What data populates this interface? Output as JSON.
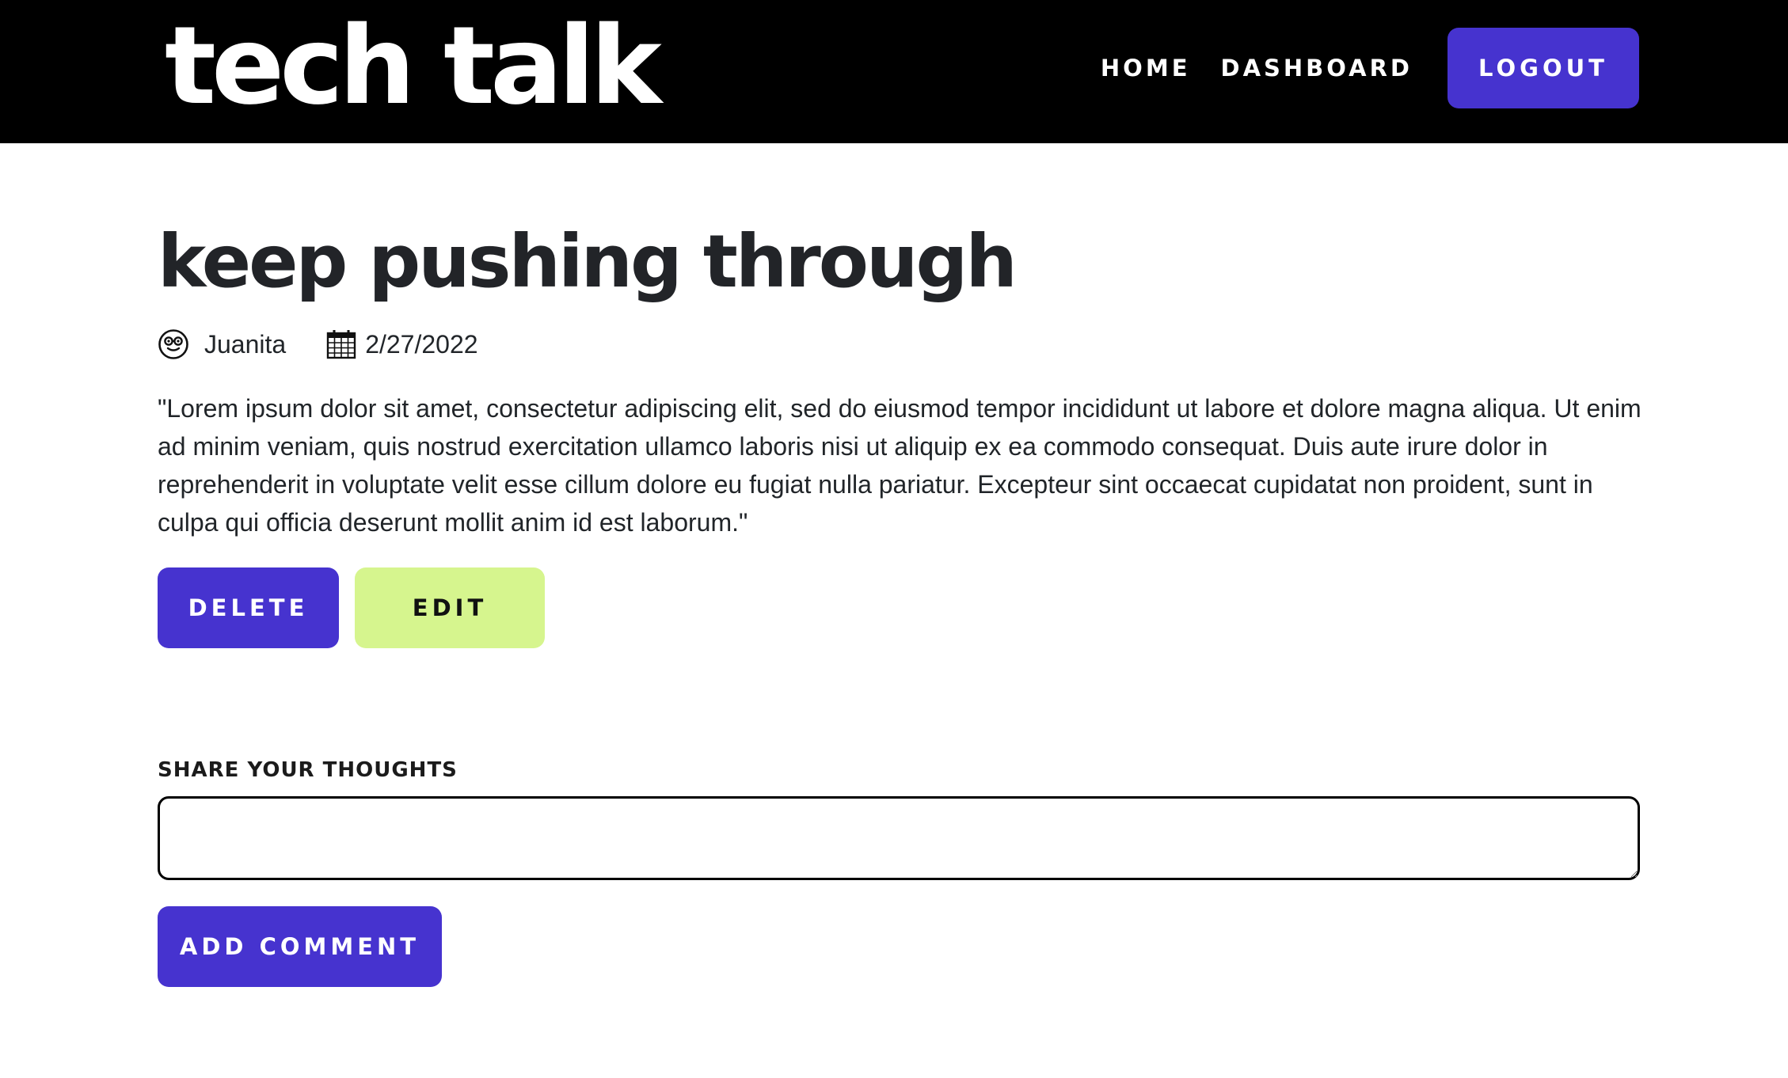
{
  "header": {
    "brand": "tech talk",
    "nav": {
      "home_label": "HOME",
      "dashboard_label": "DASHBOARD",
      "logout_label": "LOGOUT"
    }
  },
  "post": {
    "title": "keep pushing through",
    "author": "Juanita",
    "author_icon": "user-glasses-icon",
    "date": "2/27/2022",
    "date_icon": "calendar-icon",
    "body": "\"Lorem ipsum dolor sit amet, consectetur adipiscing elit, sed do eiusmod tempor incididunt ut labore et dolore magna aliqua. Ut enim ad minim veniam, quis nostrud exercitation ullamco laboris nisi ut aliquip ex ea commodo consequat. Duis aute irure dolor in reprehenderit in voluptate velit esse cillum dolore eu fugiat nulla pariatur. Excepteur sint occaecat cupidatat non proident, sunt in culpa qui officia deserunt mollit anim id est laborum.\"",
    "delete_label": "DELETE",
    "edit_label": "EDIT"
  },
  "comment_form": {
    "label": "SHARE YOUR THOUGHTS",
    "value": "",
    "submit_label": "ADD COMMENT"
  },
  "colors": {
    "header_bg": "#000000",
    "primary": "#4633cf",
    "edit_bg": "#d6f58e",
    "text": "#212529"
  }
}
